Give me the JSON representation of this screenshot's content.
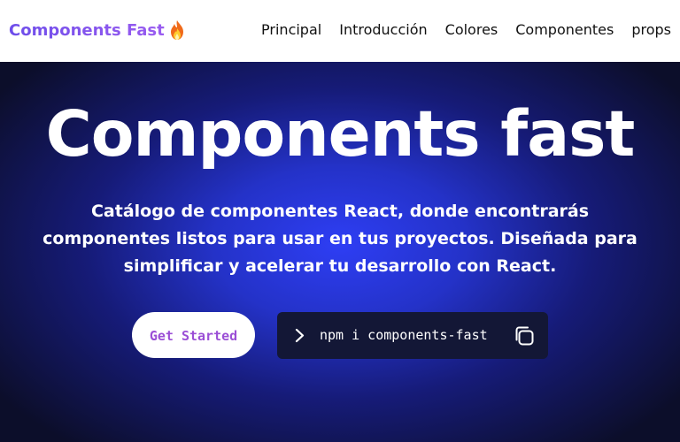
{
  "navbar": {
    "brand": "Components Fast",
    "brand_icon": "fire-icon",
    "links": [
      "Principal",
      "Introducción",
      "Colores",
      "Componentes",
      "props"
    ]
  },
  "hero": {
    "title": "Components fast",
    "description": "Catálogo de componentes React, donde encontrarás componentes listos para usar en tus proyectos. Diseñada para simplificar y acelerar tu desarrollo con React.",
    "cta_label": "Get Started",
    "install_command": "npm i components-fast",
    "prompt_icon": "chevron-right-icon",
    "copy_icon": "copy-icon"
  },
  "colors": {
    "brand_gradient_start": "#6d4dea",
    "brand_gradient_end": "#9a5cf0",
    "hero_center": "#2e3ef4",
    "hero_edge": "#0c0e2a",
    "cta_text": "#9b4fd6",
    "install_bg": "#131736"
  }
}
